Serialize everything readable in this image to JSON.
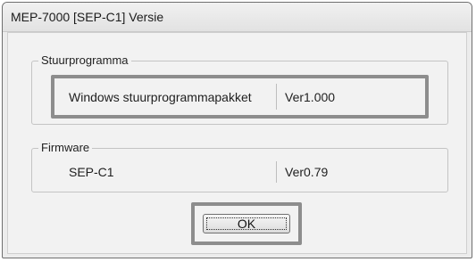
{
  "window": {
    "title": "MEP-7000 [SEP-C1] Versie"
  },
  "driver_group": {
    "label": "Stuurprogramma",
    "name": "Windows stuurprogrammapakket",
    "version": "Ver1.000"
  },
  "firmware_group": {
    "label": "Firmware",
    "name": "SEP-C1",
    "version": "Ver0.79"
  },
  "buttons": {
    "ok_label": "OK"
  }
}
